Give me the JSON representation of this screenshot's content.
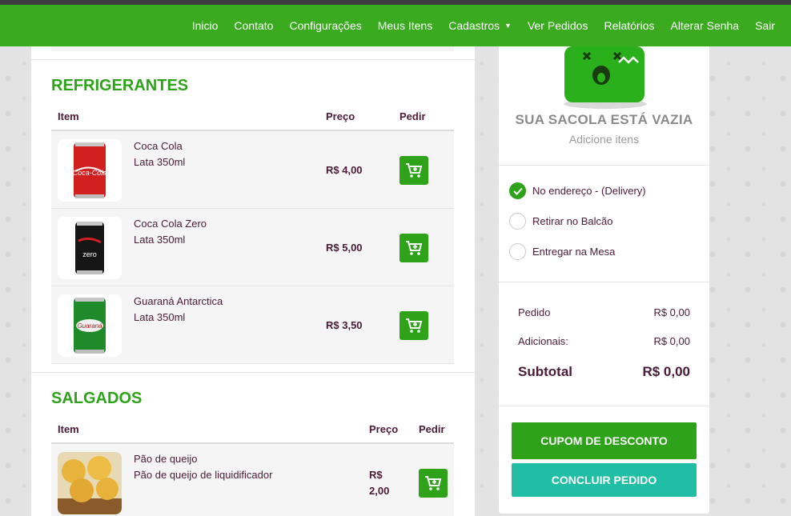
{
  "nav": {
    "items": [
      "Inicio",
      "Contato",
      "Configurações",
      "Meus Itens",
      "Cadastros",
      "Ver Pedidos",
      "Relatórios",
      "Alterar Senha",
      "Sair"
    ]
  },
  "menu": {
    "refrigerantes": {
      "title": "REFRIGERANTES",
      "headers": {
        "item": "Item",
        "price": "Preço",
        "order": "Pedir"
      },
      "products": [
        {
          "name": "Coca Cola",
          "desc": "Lata 350ml",
          "price": "R$ 4,00"
        },
        {
          "name": "Coca Cola Zero",
          "desc": "Lata 350ml",
          "price": "R$ 5,00"
        },
        {
          "name": "Guaraná Antarctica",
          "desc": "Lata 350ml",
          "price": "R$ 3,50"
        }
      ]
    },
    "salgados": {
      "title": "SALGADOS",
      "headers": {
        "item": "Item",
        "price": "Preço",
        "order": "Pedir"
      },
      "products": [
        {
          "name": "Pão de queijo",
          "desc": "Pão de queijo de liquidificador",
          "price_line1": "R$",
          "price_line2": "2,00"
        }
      ]
    }
  },
  "bag": {
    "empty_title": "SUA SACOLA ESTÁ VAZIA",
    "empty_subtitle": "Adicione itens",
    "delivery_options": [
      {
        "label": "No endereço - (Delivery)",
        "selected": true
      },
      {
        "label": "Retirar no Balcão",
        "selected": false
      },
      {
        "label": "Entregar na Mesa",
        "selected": false
      }
    ],
    "summary": {
      "pedido_label": "Pedido",
      "pedido_value": "R$ 0,00",
      "adicionais_label": "Adicionais:",
      "adicionais_value": "R$ 0,00",
      "subtotal_label": "Subtotal",
      "subtotal_value": "R$ 0,00"
    },
    "coupon_button": "CUPOM DE DESCONTO",
    "finish_button": "CONCLUIR PEDIDO"
  },
  "colors": {
    "brand_green": "#3aaa1f",
    "title_green": "#2ea31a",
    "teal": "#20bfa5",
    "text_purple": "#4a1a38"
  },
  "icons": [
    "cart-plus-icon",
    "chevron-down-icon",
    "check-icon",
    "empty-bag-icon"
  ]
}
